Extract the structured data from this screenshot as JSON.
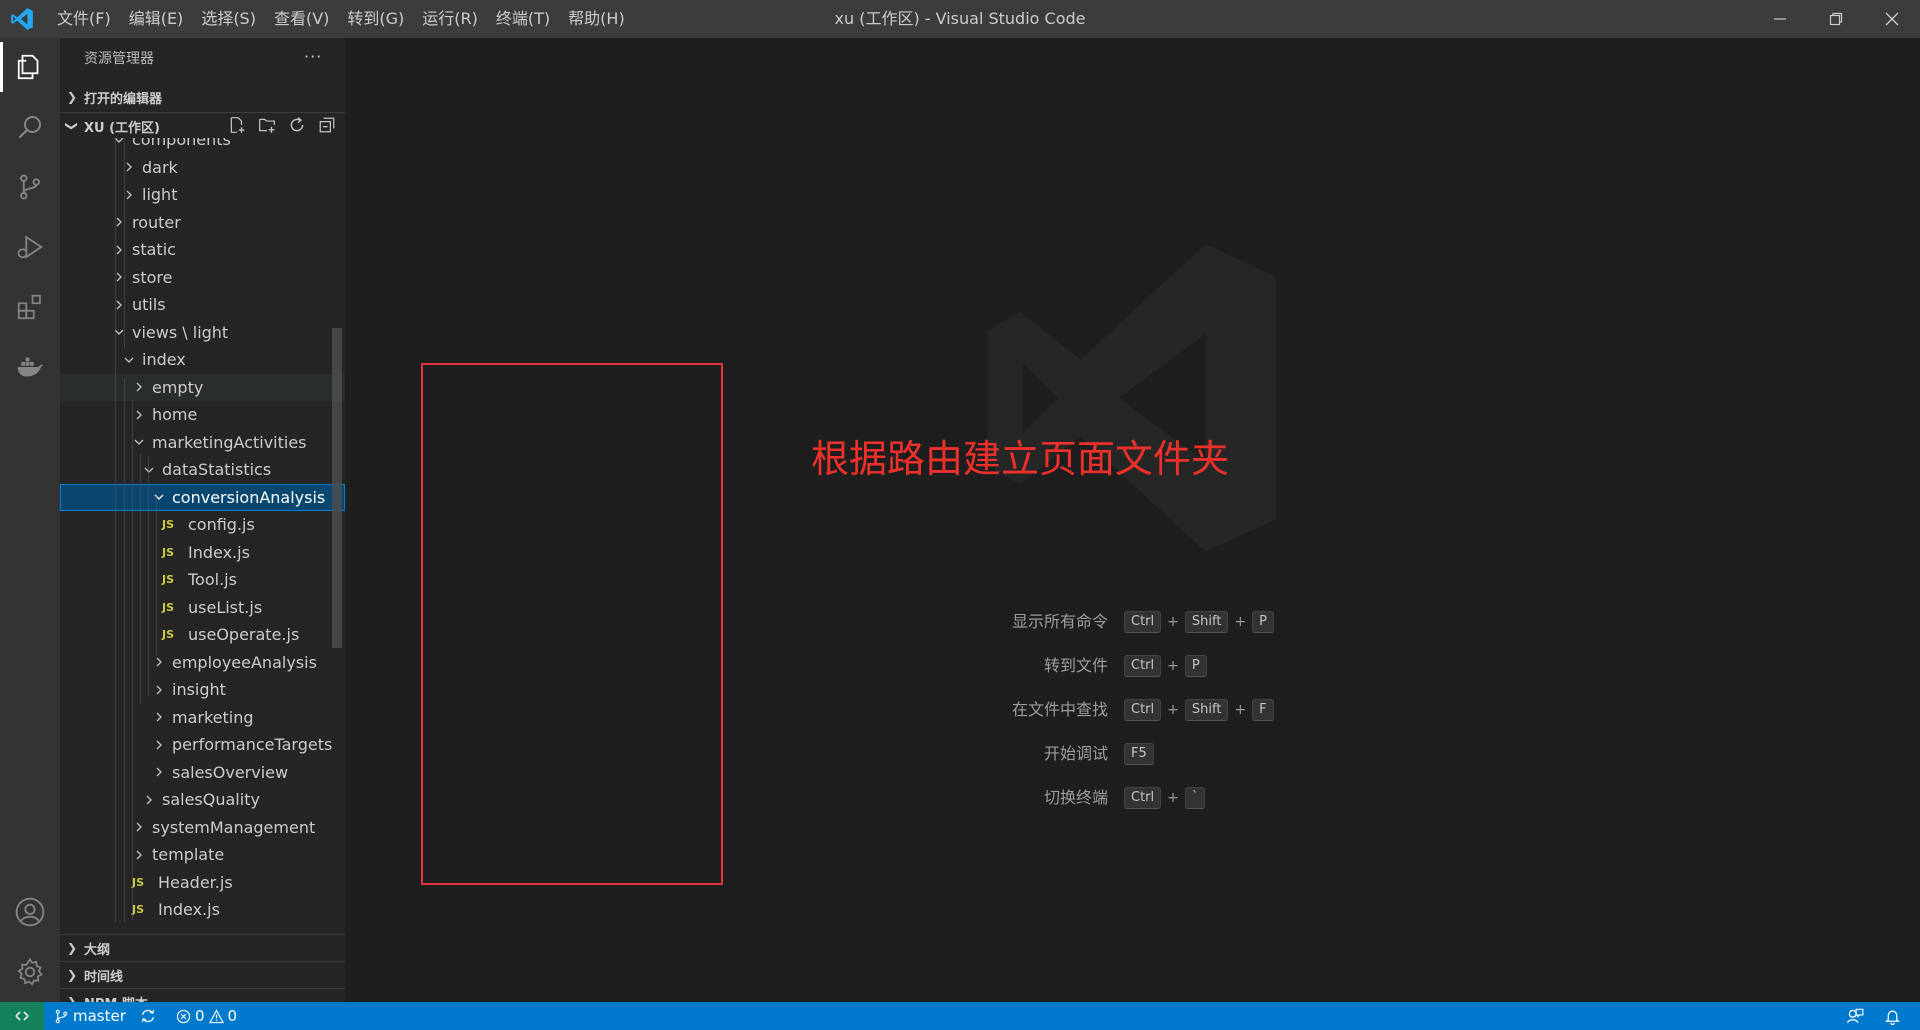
{
  "window": {
    "title": "xu (工作区) - Visual Studio Code",
    "menu": [
      "文件(F)",
      "编辑(E)",
      "选择(S)",
      "查看(V)",
      "转到(G)",
      "运行(R)",
      "终端(T)",
      "帮助(H)"
    ]
  },
  "activity_bar": {
    "icons": [
      "explorer-icon",
      "search-icon",
      "source-control-icon",
      "run-debug-icon",
      "extensions-icon",
      "docker-icon",
      "account-icon",
      "settings-gear-icon"
    ],
    "active": "explorer-icon"
  },
  "sidebar": {
    "title": "资源管理器",
    "more": "···",
    "sections": {
      "open_editors": "打开的编辑器",
      "workspace": "XU (工作区)",
      "outline": "大纲",
      "timeline": "时间线",
      "npm_scripts": "NPM 脚本"
    },
    "tree": [
      {
        "label": "components",
        "type": "folder",
        "expanded": true,
        "depth": 1
      },
      {
        "label": "dark",
        "type": "folder",
        "expanded": false,
        "depth": 2
      },
      {
        "label": "light",
        "type": "folder",
        "expanded": false,
        "depth": 2
      },
      {
        "label": "router",
        "type": "folder",
        "expanded": false,
        "depth": 1
      },
      {
        "label": "static",
        "type": "folder",
        "expanded": false,
        "depth": 1
      },
      {
        "label": "store",
        "type": "folder",
        "expanded": false,
        "depth": 1
      },
      {
        "label": "utils",
        "type": "folder",
        "expanded": false,
        "depth": 1
      },
      {
        "label": "views \\ light",
        "type": "folder",
        "expanded": true,
        "depth": 1
      },
      {
        "label": "index",
        "type": "folder",
        "expanded": true,
        "depth": 2
      },
      {
        "label": "empty",
        "type": "folder",
        "expanded": false,
        "depth": 3,
        "hover": true
      },
      {
        "label": "home",
        "type": "folder",
        "expanded": false,
        "depth": 3
      },
      {
        "label": "marketingActivities",
        "type": "folder",
        "expanded": true,
        "depth": 3
      },
      {
        "label": "dataStatistics",
        "type": "folder",
        "expanded": true,
        "depth": 4
      },
      {
        "label": "conversionAnalysis",
        "type": "folder",
        "expanded": true,
        "depth": 5,
        "selected": true
      },
      {
        "label": "config.js",
        "type": "js",
        "depth": 6
      },
      {
        "label": "Index.js",
        "type": "js",
        "depth": 6
      },
      {
        "label": "Tool.js",
        "type": "js",
        "depth": 6
      },
      {
        "label": "useList.js",
        "type": "js",
        "depth": 6
      },
      {
        "label": "useOperate.js",
        "type": "js",
        "depth": 6
      },
      {
        "label": "employeeAnalysis",
        "type": "folder",
        "expanded": false,
        "depth": 5
      },
      {
        "label": "insight",
        "type": "folder",
        "expanded": false,
        "depth": 5
      },
      {
        "label": "marketing",
        "type": "folder",
        "expanded": false,
        "depth": 5
      },
      {
        "label": "performanceTargets",
        "type": "folder",
        "expanded": false,
        "depth": 5
      },
      {
        "label": "salesOverview",
        "type": "folder",
        "expanded": false,
        "depth": 5
      },
      {
        "label": "salesQuality",
        "type": "folder",
        "expanded": false,
        "depth": 4
      },
      {
        "label": "systemManagement",
        "type": "folder",
        "expanded": false,
        "depth": 3
      },
      {
        "label": "template",
        "type": "folder",
        "expanded": false,
        "depth": 3
      },
      {
        "label": "Header.js",
        "type": "js",
        "depth": 3
      },
      {
        "label": "Index.js",
        "type": "js",
        "depth": 3
      }
    ]
  },
  "editor": {
    "annotation": "根据路由建立页面文件夹",
    "annotation_color": "#f0312b",
    "shortcuts": [
      {
        "label": "显示所有命令",
        "keys": [
          "Ctrl",
          "Shift",
          "P"
        ]
      },
      {
        "label": "转到文件",
        "keys": [
          "Ctrl",
          "P"
        ]
      },
      {
        "label": "在文件中查找",
        "keys": [
          "Ctrl",
          "Shift",
          "F"
        ]
      },
      {
        "label": "开始调试",
        "keys": [
          "F5"
        ]
      },
      {
        "label": "切换终端",
        "keys": [
          "Ctrl",
          "`"
        ]
      }
    ]
  },
  "statusbar": {
    "branch": "master",
    "errors": "0",
    "warnings": "0",
    "color": "#007acc"
  }
}
